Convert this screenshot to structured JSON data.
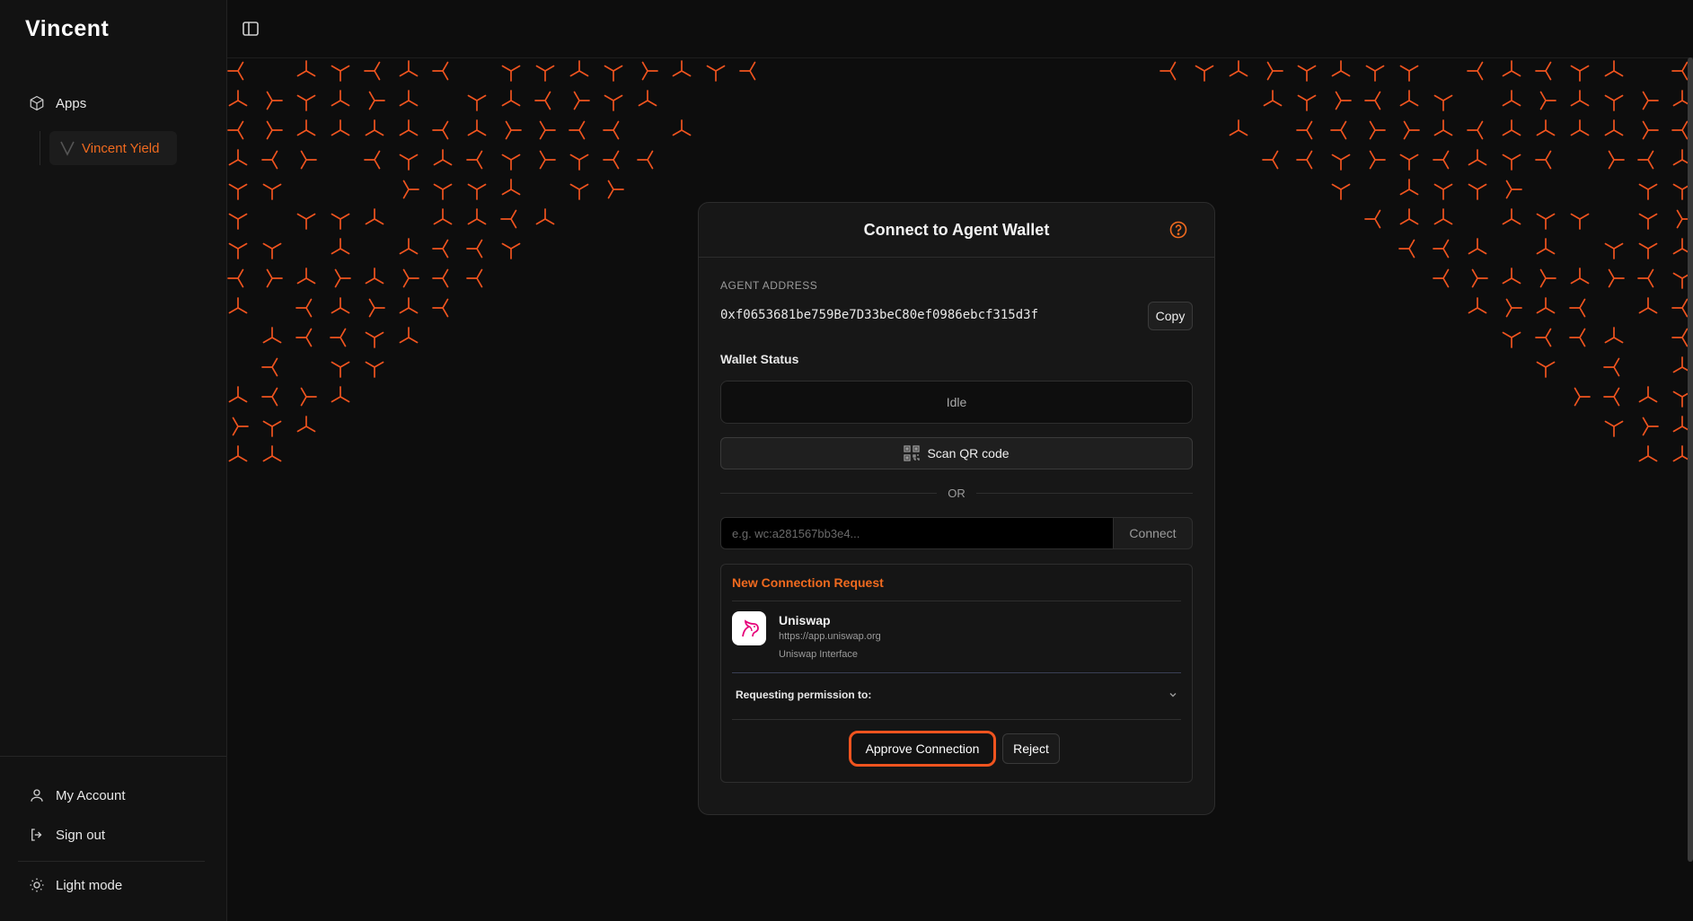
{
  "brand": {
    "logo_text": "Vincent"
  },
  "sidebar": {
    "apps_label": "Apps",
    "sub_items": [
      {
        "label": "Vincent Yield"
      }
    ],
    "bottom_items": [
      {
        "label": "My Account",
        "icon": "user-icon"
      },
      {
        "label": "Sign out",
        "icon": "sign-out-icon"
      },
      {
        "label": "Light mode",
        "icon": "sun-icon"
      }
    ]
  },
  "card": {
    "title": "Connect to Agent Wallet",
    "agent_address_label": "AGENT ADDRESS",
    "agent_address": "0xf0653681be759Be7D33beC80ef0986ebcf315d3f",
    "copy_label": "Copy",
    "wallet_status_label": "Wallet Status",
    "wallet_status_value": "Idle",
    "scan_qr_label": "Scan QR code",
    "or_label": "OR",
    "uri_placeholder": "e.g. wc:a281567bb3e4...",
    "connect_label": "Connect"
  },
  "request": {
    "title": "New Connection Request",
    "dapp_name": "Uniswap",
    "dapp_url": "https://app.uniswap.org",
    "dapp_description": "Uniswap Interface",
    "permission_label": "Requesting permission to:",
    "approve_label": "Approve Connection",
    "reject_label": "Reject"
  },
  "colors": {
    "accent": "#f06a1f",
    "pattern": "#f0541f",
    "background": "#0d0d0d",
    "card": "#171717"
  }
}
